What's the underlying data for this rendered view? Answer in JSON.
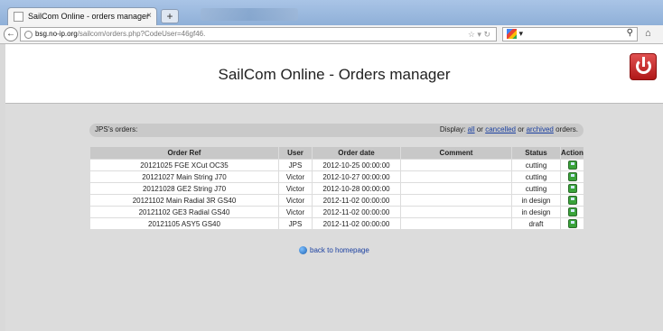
{
  "browser": {
    "tab_title": "SailCom Online - orders manager",
    "new_tab_label": "+",
    "url_host": "bsg.no-ip.org",
    "url_path": "/sailcom/orders.php?CodeUser=46gf46."
  },
  "header": {
    "title": "SailCom Online - Orders manager"
  },
  "orders": {
    "title": "JPS's orders:",
    "display_prefix": "Display:",
    "all_link": "all",
    "or1": "or",
    "cancelled_link": "cancelled",
    "or2": "or",
    "archived_link": "archived",
    "suffix": "orders."
  },
  "table": {
    "columns": [
      "Order Ref",
      "User",
      "Order date",
      "Comment",
      "Status",
      "Action"
    ],
    "rows": [
      [
        "20121025 FGE XCut OC35",
        "JPS",
        "2012-10-25 00:00:00",
        "",
        "cutting"
      ],
      [
        "20121027 Main String J70",
        "Victor",
        "2012-10-27 00:00:00",
        "",
        "cutting"
      ],
      [
        "20121028 GE2 String J70",
        "Victor",
        "2012-10-28 00:00:00",
        "",
        "cutting"
      ],
      [
        "20121102 Main Radial 3R GS40",
        "Victor",
        "2012-11-02 00:00:00",
        "",
        "in design"
      ],
      [
        "20121102 GE3 Radial GS40",
        "Victor",
        "2012-11-02 00:00:00",
        "",
        "in design"
      ],
      [
        "20121105 ASY5 GS40",
        "JPS",
        "2012-11-02 00:00:00",
        "",
        "draft"
      ]
    ]
  },
  "footer": {
    "back_link": "back to homepage"
  },
  "colors": {
    "power_button": "#c62828",
    "link": "#1a3fa0",
    "action_icon": "#3aa33a"
  }
}
